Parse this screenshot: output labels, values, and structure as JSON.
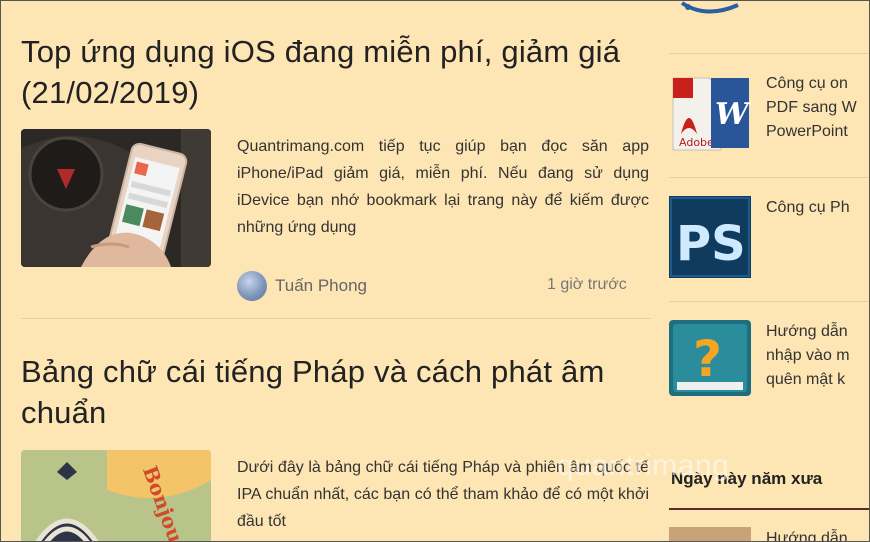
{
  "articles": [
    {
      "title": "Top ứng dụng iOS đang miễn phí, giảm giá (21/02/2019)",
      "excerpt": "Quantrimang.com tiếp tục giúp bạn đọc săn app iPhone/iPad giảm giá, miễn phí. Nếu đang sử dụng iDevice bạn nhớ bookmark lại trang này để kiếm được những ứng dụng",
      "author": "Tuấn Phong",
      "time": "1 giờ trước"
    },
    {
      "title": "Bảng chữ cái tiếng Pháp và cách phát âm chuẩn",
      "excerpt": "Dưới đây là bảng chữ cái tiếng Pháp và phiên âm quốc tế IPA chuẩn nhất, các bạn có thể tham khảo để có một khởi đầu tốt",
      "thumb_text": "Bonjour"
    }
  ],
  "sidebar": {
    "items": [
      {
        "text_line1": "Công cụ on",
        "text_line2": "PDF sang W",
        "text_line3": "PowerPoint",
        "thumb_label": "Adobe"
      },
      {
        "text_line1": "Công cụ Ph",
        "thumb_label": "PS"
      },
      {
        "text_line1": "Hướng dẫn",
        "text_line2": "nhập vào m",
        "text_line3": "quên mật k",
        "thumb_label": "?"
      },
      {
        "text_line1": "Hướng dẫn"
      }
    ],
    "section_heading": "Ngày này năm xưa"
  },
  "watermark": "quantrimang"
}
